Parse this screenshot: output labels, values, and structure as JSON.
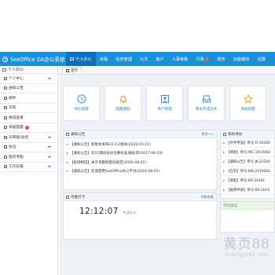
{
  "app": {
    "title": "SeeOffice OA办公系统"
  },
  "nav": {
    "items": [
      {
        "label": "个人办公",
        "icon": "monitor-icon",
        "active": true
      },
      {
        "label": "流程",
        "icon": "",
        "active": false
      },
      {
        "label": "任务管理",
        "icon": "",
        "active": false
      },
      {
        "label": "公文",
        "icon": "",
        "active": false
      },
      {
        "label": "客户",
        "icon": "",
        "active": false
      },
      {
        "label": "人事考勤",
        "icon": "",
        "active": false
      },
      {
        "label": "行政",
        "icon": "",
        "active": false,
        "badge": "1"
      },
      {
        "label": "报告",
        "icon": "",
        "active": false
      },
      {
        "label": "功能模块",
        "icon": "",
        "active": false
      },
      {
        "label": "设置",
        "icon": "",
        "active": false
      }
    ]
  },
  "sidebar": {
    "header": "个人办公",
    "items": [
      {
        "label": "个人中心",
        "caret": true
      },
      {
        "label": "通知公告",
        "caret": false
      },
      {
        "label": "邮件",
        "caret": false
      },
      {
        "label": "日程",
        "caret": false
      },
      {
        "label": "换班查看",
        "caret": false
      },
      {
        "label": "单据提醒",
        "caret": false,
        "badge": "1"
      },
      {
        "label": "日周报/总结",
        "caret": true
      },
      {
        "label": "协议",
        "caret": true
      },
      {
        "label": "我的考勤",
        "caret": true
      },
      {
        "label": "工作日报",
        "caret": true
      }
    ]
  },
  "tabs": {
    "home": "首页"
  },
  "quick": [
    {
      "label": "待办提醒",
      "icon": "clock-icon"
    },
    {
      "label": "提醒通知",
      "icon": "bell-icon"
    },
    {
      "label": "用户管理",
      "icon": "user-icon"
    },
    {
      "label": "我未完成任务",
      "icon": "inbox-icon"
    },
    {
      "label": "单据提醒",
      "icon": "star-icon"
    }
  ],
  "notices": {
    "title": "通知公告",
    "more": "更多>>",
    "items": [
      "【通知公告】新版本发布V2.0.2版本(2020-03-21)",
      "【通知公告】双11期间会员优惠标准通知(新)2017-08-29)",
      "【规则制度】关于考勤制度的规定(2016-08-01)",
      "【通知公告】欢迎使用SeeOffice办公平台(2016-08-01)"
    ]
  },
  "attendance": {
    "title": "考勤打卡",
    "more": "考勤查看",
    "time": "12:12:07",
    "sub": "今日打卡："
  },
  "todo": {
    "title": "我的待办",
    "items": [
      "【文件传送】单号:FI-20200",
      "【请款】单号:WC-2019002",
      "【通知公告】单号:JK-20190",
      "【任务】单号:KW-2019042",
      "【请假】单号:KR-20181",
      "【报销申请】单号:BX-2016"
    ]
  },
  "meeting": {
    "title": "今日会议"
  },
  "watermark": {
    "main": "黄页88",
    "sub": "huangye88.com"
  }
}
